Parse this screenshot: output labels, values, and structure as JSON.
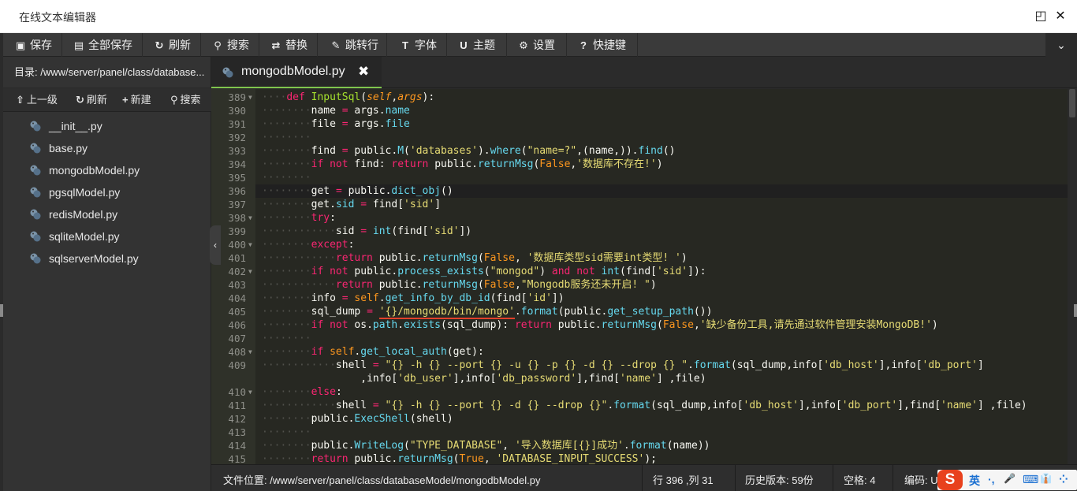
{
  "window": {
    "title": "在线文本编辑器",
    "restore_glyph": "◰",
    "close_glyph": "✕"
  },
  "toolbar": {
    "items": [
      {
        "icon": "floppy-icon",
        "glyph": "▣",
        "label": "保存"
      },
      {
        "icon": "save-all-icon",
        "glyph": "▤",
        "label": "全部保存"
      },
      {
        "icon": "refresh-icon",
        "glyph": "↻",
        "label": "刷新"
      },
      {
        "icon": "search-icon",
        "glyph": "⚲",
        "label": "搜索"
      },
      {
        "icon": "replace-icon",
        "glyph": "⇄",
        "label": "替换"
      },
      {
        "icon": "pin-icon",
        "glyph": "✎",
        "label": "跳转行"
      },
      {
        "icon": "text-icon",
        "glyph": "T",
        "label": "字体"
      },
      {
        "icon": "theme-icon",
        "glyph": "U",
        "label": "主题"
      },
      {
        "icon": "gear-icon",
        "glyph": "⚙",
        "label": "设置"
      },
      {
        "icon": "help-icon",
        "glyph": "?",
        "label": "快捷键"
      }
    ],
    "collapse_glyph": "⌄"
  },
  "sidebar": {
    "path": "目录: /www/server/panel/class/database...",
    "actions": [
      {
        "glyph": "⇧",
        "label": "上一级"
      },
      {
        "glyph": "↻",
        "label": "刷新"
      },
      {
        "glyph": "+",
        "label": "新建"
      },
      {
        "glyph": "⚲",
        "label": "搜索"
      }
    ],
    "files": [
      "__init__.py",
      "base.py",
      "mongodbModel.py",
      "pgsqlModel.py",
      "redisModel.py",
      "sqliteModel.py",
      "sqlserverModel.py"
    ],
    "toggle_glyph": "‹"
  },
  "tab": {
    "label": "mongodbModel.py",
    "close": "✖"
  },
  "editor": {
    "lines": [
      {
        "n": "389",
        "fold": true
      },
      {
        "n": "390",
        "fold": false
      },
      {
        "n": "391",
        "fold": false
      },
      {
        "n": "392",
        "fold": false
      },
      {
        "n": "393",
        "fold": false
      },
      {
        "n": "394",
        "fold": false
      },
      {
        "n": "395",
        "fold": false
      },
      {
        "n": "396",
        "fold": false
      },
      {
        "n": "397",
        "fold": false
      },
      {
        "n": "398",
        "fold": true
      },
      {
        "n": "399",
        "fold": false
      },
      {
        "n": "400",
        "fold": true
      },
      {
        "n": "401",
        "fold": false
      },
      {
        "n": "402",
        "fold": true
      },
      {
        "n": "403",
        "fold": false
      },
      {
        "n": "404",
        "fold": false
      },
      {
        "n": "405",
        "fold": false
      },
      {
        "n": "406",
        "fold": false
      },
      {
        "n": "407",
        "fold": false
      },
      {
        "n": "408",
        "fold": true
      },
      {
        "n": "409",
        "fold": false
      },
      {
        "n": "",
        "fold": false
      },
      {
        "n": "410",
        "fold": true
      },
      {
        "n": "411",
        "fold": false
      },
      {
        "n": "412",
        "fold": false
      },
      {
        "n": "413",
        "fold": false
      },
      {
        "n": "414",
        "fold": false
      },
      {
        "n": "415",
        "fold": false
      }
    ],
    "code": {
      "l389": [
        "def",
        "InputSql",
        "self",
        "args"
      ],
      "l390": [
        "name",
        "args",
        "name"
      ],
      "l391": [
        "file",
        "args",
        "file"
      ],
      "l393": [
        "find",
        "public",
        "M",
        "'databases'",
        "where",
        "\"name=?\"",
        "name",
        "find"
      ],
      "l394": [
        "if",
        "not",
        "find:",
        "return",
        "public",
        "returnMsg",
        "False",
        "'数据库不存在!'"
      ],
      "l396": [
        "get",
        "public",
        "dict_obj"
      ],
      "l397": [
        "get",
        "sid",
        "find",
        "'sid'"
      ],
      "l398": [
        "try"
      ],
      "l399": [
        "sid",
        "int",
        "find",
        "'sid'"
      ],
      "l400": [
        "except"
      ],
      "l401": [
        "return",
        "public",
        "returnMsg",
        "False",
        "'数据库类型sid需要int类型! '"
      ],
      "l402": [
        "if",
        "not",
        "public",
        "process_exists",
        "\"mongod\"",
        "and",
        "not",
        "int",
        "find",
        "'sid'"
      ],
      "l403": [
        "return",
        "public",
        "returnMsg",
        "False",
        "\"Mongodb服务还未开启! \""
      ],
      "l404": [
        "info",
        "self",
        "get_info_by_db_id",
        "find",
        "'id'"
      ],
      "l405": [
        "sql_dump",
        "'{}/mongodb/bin/mongo'",
        "format",
        "public",
        "get_setup_path"
      ],
      "l406": [
        "if",
        "not",
        "os",
        "path",
        "exists",
        "sql_dump",
        "return",
        "public",
        "returnMsg",
        "False",
        "'缺少备份工具,请先通过软件管理安装MongoDB!'"
      ],
      "l408": [
        "if",
        "self",
        "get_local_auth",
        "get"
      ],
      "l409": [
        "shell",
        "\"{} -h {} --port {} -u {} -p {} -d {} --drop {} \"",
        "format",
        "sql_dump",
        "info",
        "'db_host'",
        "info",
        "'db_port'"
      ],
      "l409b": [
        "info",
        "'db_user'",
        "info",
        "'db_password'",
        "find",
        "'name'",
        "file"
      ],
      "l410": [
        "else"
      ],
      "l411": [
        "shell",
        "\"{} -h {} --port {} -d {} --drop {}\"",
        "format",
        "sql_dump",
        "info",
        "'db_host'",
        "info",
        "'db_port'",
        "find",
        "'name'",
        "file"
      ],
      "l412": [
        "public",
        "ExecShell",
        "shell"
      ],
      "l414": [
        "public",
        "WriteLog",
        "\"TYPE_DATABASE\"",
        "'导入数据库[{}]成功'",
        "format",
        "name"
      ],
      "l415": [
        "return",
        "public",
        "returnMsg",
        "True",
        "'DATABASE_INPUT_SUCCESS'"
      ]
    }
  },
  "status": {
    "location": "文件位置: /www/server/panel/class/databaseModel/mongodbModel.py",
    "cursor": "行 396 ,列 31",
    "history": "历史版本: 59份",
    "spaces": "空格: 4",
    "encoding": "编码: U"
  },
  "ime": {
    "logo": "S",
    "lang": "英",
    "icons": [
      "·,",
      "🎤",
      "⌨",
      "👔",
      "⁘"
    ]
  }
}
